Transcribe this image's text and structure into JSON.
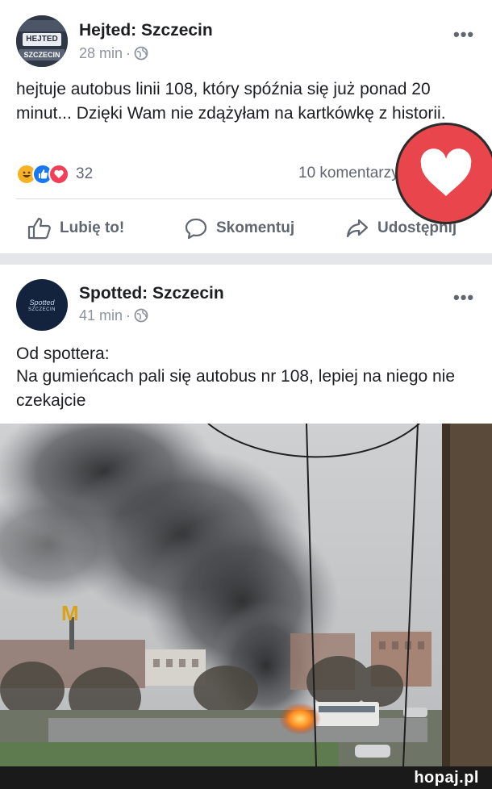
{
  "post1": {
    "page_name": "Hejted: Szczecin",
    "time": "28 min",
    "avatar_lines": [
      "HEJTED",
      "SZCZECIN"
    ],
    "text": "hejtuje autobus linii 108, który spóźnia się już ponad 20 minut... Dzięki Wam nie zdążyłam na kartkówkę z historii.",
    "reaction_count": "32",
    "comments": "10 komentarzy",
    "actions": {
      "like": "Lubię to!",
      "comment": "Skomentuj",
      "share": "Udostępnij"
    }
  },
  "post2": {
    "page_name": "Spotted: Szczecin",
    "time": "41 min",
    "avatar_lines": [
      "Spotted",
      "SZCZECIN"
    ],
    "text_line1": "Od spottera:",
    "text_line2": "Na gumieńcach pali się autobus nr 108, lepiej na niego nie czekajcie"
  },
  "footer": {
    "logo": "hopaj.pl"
  },
  "colors": {
    "facebook_blue": "#385898",
    "like_blue": "#1877f2",
    "love_red": "#f33e58",
    "haha_yellow": "#f7b125",
    "badge_red": "#e8454c"
  },
  "icons": [
    "globe-icon",
    "more-icon",
    "like-icon",
    "comment-icon",
    "share-icon",
    "heart-icon"
  ]
}
